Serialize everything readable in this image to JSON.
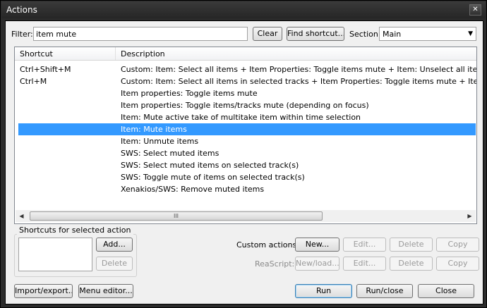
{
  "window": {
    "title": "Actions",
    "close_glyph": "✕"
  },
  "filter": {
    "label": "Filter:",
    "value": "item mute"
  },
  "buttons": {
    "clear": "Clear",
    "find_shortcut": "Find shortcut..."
  },
  "section": {
    "label": "Section:",
    "value": "Main"
  },
  "list": {
    "headers": {
      "shortcut": "Shortcut",
      "description": "Description"
    },
    "rows": [
      {
        "shortcut": "Ctrl+Shift+M",
        "description": "Custom: Item: Select all items + Item Properties: Toggle items mute + Item: Unselect all items"
      },
      {
        "shortcut": "Ctrl+M",
        "description": "Custom: Item: Select all items in selected tracks + Item Properties: Toggle items mute + Item: Unselect all ite"
      },
      {
        "shortcut": "",
        "description": "Item properties: Toggle items mute"
      },
      {
        "shortcut": "",
        "description": "Item properties: Toggle items/tracks mute (depending on focus)"
      },
      {
        "shortcut": "",
        "description": "Item: Mute active take of multitake item within time selection"
      },
      {
        "shortcut": "",
        "description": "Item: Mute items",
        "selected": true
      },
      {
        "shortcut": "",
        "description": "Item: Unmute items"
      },
      {
        "shortcut": "",
        "description": "SWS: Select muted items"
      },
      {
        "shortcut": "",
        "description": "SWS: Select muted items on selected track(s)"
      },
      {
        "shortcut": "",
        "description": "SWS: Toggle mute of items on selected track(s)"
      },
      {
        "shortcut": "",
        "description": "Xenakios/SWS: Remove muted items"
      }
    ],
    "scroll_left_glyph": "◀",
    "scroll_right_glyph": "▶",
    "scroll_grip_glyph": "III"
  },
  "shortcuts_group": {
    "title": "Shortcuts for selected action",
    "add": "Add...",
    "delete": "Delete"
  },
  "custom_actions": {
    "label": "Custom actions:",
    "new": "New...",
    "edit": "Edit...",
    "delete": "Delete",
    "copy": "Copy"
  },
  "reascript": {
    "label": "ReaScript:",
    "new_load": "New/load...",
    "edit": "Edit...",
    "delete": "Delete",
    "copy": "Copy"
  },
  "bottom": {
    "import_export": "Import/export...",
    "menu_editor": "Menu editor...",
    "run": "Run",
    "run_close": "Run/close",
    "close": "Close"
  }
}
